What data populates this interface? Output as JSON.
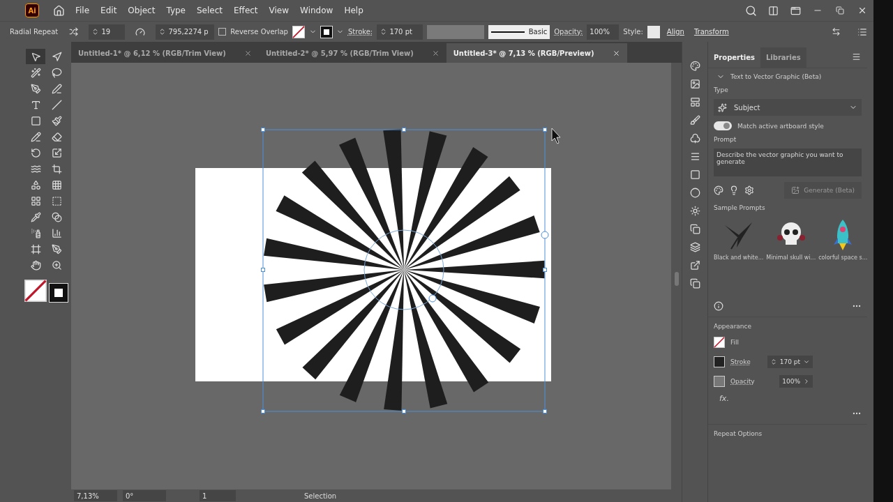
{
  "app": {
    "logo": "Ai"
  },
  "menu": [
    "File",
    "Edit",
    "Object",
    "Type",
    "Select",
    "Effect",
    "View",
    "Window",
    "Help"
  ],
  "control_bar": {
    "tool_name": "Radial Repeat",
    "instances": "19",
    "radius": "795,2274 p",
    "reverse_overlap": {
      "label": "Reverse Overlap",
      "checked": false
    },
    "stroke_label": "Stroke:",
    "stroke_weight": "170 pt",
    "brush": "Basic",
    "opacity_label": "Opacity:",
    "opacity": "100%",
    "style_label": "Style:",
    "align": "Align",
    "transform": "Transform"
  },
  "tabs": [
    {
      "label": "Untitled-1* @ 6,12 % (RGB/Trim View)",
      "selected": false
    },
    {
      "label": "Untitled-2* @ 5,97 % (RGB/Trim View)",
      "selected": false
    },
    {
      "label": "Untitled-3* @ 7,13 % (RGB/Preview)",
      "selected": true
    }
  ],
  "tools": [
    {
      "selected": true
    },
    {
      "selected": false
    },
    {
      "selected": false
    },
    {
      "selected": false
    },
    {
      "selected": false
    },
    {
      "selected": false
    },
    {
      "selected": false
    },
    {
      "selected": false
    },
    {
      "selected": false
    },
    {
      "selected": false
    },
    {
      "selected": false
    },
    {
      "selected": false
    },
    {
      "selected": false
    },
    {
      "selected": false
    },
    {
      "selected": false
    },
    {
      "selected": false
    },
    {
      "selected": false
    },
    {
      "selected": false
    },
    {
      "selected": false
    },
    {
      "selected": false
    },
    {
      "selected": false
    },
    {
      "selected": false
    },
    {
      "selected": false
    },
    {
      "selected": false
    },
    {
      "selected": false
    },
    {
      "selected": false
    },
    {
      "selected": false
    },
    {
      "selected": false
    }
  ],
  "status_bar": {
    "zoom": "7,13%",
    "rotation": "0°",
    "artboard": "1",
    "tool": "Selection"
  },
  "panel": {
    "tabs": [
      {
        "label": "Properties",
        "selected": true
      },
      {
        "label": "Libraries",
        "selected": false
      }
    ],
    "section": {
      "title": "Text to Vector Graphic (Beta)",
      "expanded": true
    },
    "type_label": "Type",
    "type_value": "Subject",
    "match_style": {
      "label": "Match active artboard style",
      "on": true
    },
    "prompt_label": "Prompt",
    "prompt_placeholder": "Describe the vector graphic you want to generate",
    "generate": {
      "label": "Generate (Beta)",
      "disabled": true
    },
    "samples_label": "Sample Prompts",
    "samples": [
      {
        "caption": "Black and white...",
        "kind": "bird"
      },
      {
        "caption": "Minimal skull wi...",
        "kind": "skull"
      },
      {
        "caption": "colorful space s...",
        "kind": "rocket"
      }
    ],
    "appearance_title": "Appearance",
    "appearance": [
      {
        "kind": "fill",
        "label": "Fill"
      },
      {
        "kind": "stroke",
        "label": "Stroke",
        "value": "170 pt"
      },
      {
        "kind": "opacity",
        "label": "Opacity",
        "value": "100%"
      }
    ],
    "fx": "fx.",
    "repeat_title": "Repeat Options"
  }
}
